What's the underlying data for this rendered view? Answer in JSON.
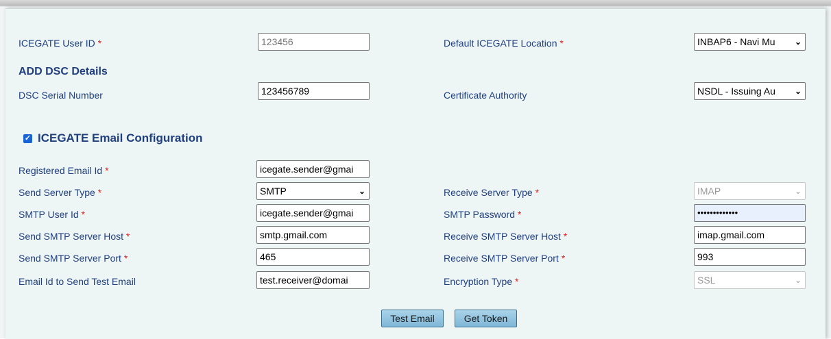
{
  "user_section": {
    "icegate_user_id_label": "ICEGATE User ID",
    "icegate_user_id_value": "123456",
    "default_location_label": "Default ICEGATE Location",
    "default_location_value": "INBAP6 - Navi Mu"
  },
  "dsc": {
    "heading": "ADD DSC Details",
    "serial_label": "DSC Serial Number",
    "serial_value": "123456789",
    "authority_label": "Certificate Authority",
    "authority_value": "NSDL - Issuing Au"
  },
  "email_config": {
    "heading": "ICEGATE Email Configuration",
    "enabled": true,
    "registered_email_label": "Registered Email Id",
    "registered_email_value": "icegate.sender@gmai",
    "send_server_type_label": "Send Server Type",
    "send_server_type_value": "SMTP",
    "receive_server_type_label": "Receive Server Type",
    "receive_server_type_value": "IMAP",
    "smtp_user_label": "SMTP User Id",
    "smtp_user_value": "icegate.sender@gmai",
    "smtp_password_label": "SMTP Password",
    "smtp_password_value": "•••••••••••••",
    "send_host_label": "Send SMTP Server Host",
    "send_host_value": "smtp.gmail.com",
    "receive_host_label": "Receive SMTP Server Host",
    "receive_host_value": "imap.gmail.com",
    "send_port_label": "Send SMTP Server Port",
    "send_port_value": "465",
    "receive_port_label": "Receive SMTP Server Port",
    "receive_port_value": "993",
    "test_email_label": "Email Id to Send Test Email",
    "test_email_value": "test.receiver@domai",
    "encryption_label": "Encryption Type",
    "encryption_value": "SSL"
  },
  "required_marker": "*",
  "checkbox_glyph": "✓",
  "chevron_glyph": "⌄",
  "buttons": {
    "test_email": "Test Email",
    "get_token": "Get Token"
  }
}
